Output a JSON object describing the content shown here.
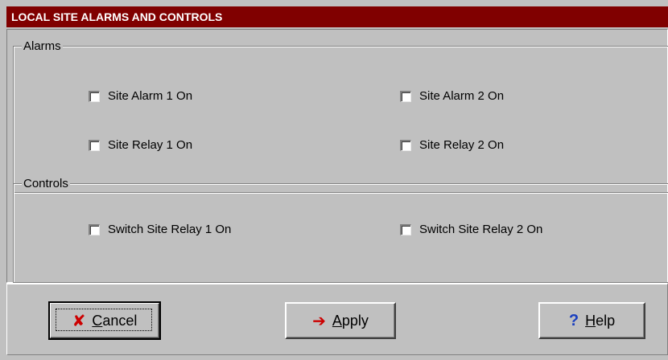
{
  "window": {
    "title": "LOCAL SITE ALARMS AND CONTROLS"
  },
  "alarms": {
    "legend": "Alarms",
    "items": [
      {
        "label": "Site Alarm 1 On",
        "checked": false
      },
      {
        "label": "Site Alarm 2 On",
        "checked": false
      },
      {
        "label": "Site Relay 1 On",
        "checked": false
      },
      {
        "label": "Site Relay 2 On",
        "checked": false
      }
    ]
  },
  "controls": {
    "legend": "Controls",
    "items": [
      {
        "label": "Switch Site Relay 1 On",
        "checked": false
      },
      {
        "label": "Switch Site Relay 2 On",
        "checked": false
      }
    ]
  },
  "buttons": {
    "cancel": {
      "icon": "x-icon",
      "mnemonic": "C",
      "rest": "ancel"
    },
    "apply": {
      "icon": "arrow-right-icon",
      "mnemonic": "A",
      "rest": "pply"
    },
    "help": {
      "icon": "question-icon",
      "mnemonic": "H",
      "rest": "elp"
    }
  },
  "colors": {
    "titlebar": "#800000",
    "face": "#c0c0c0",
    "cancel_icon": "#cc0000",
    "help_icon": "#1a3fbf"
  }
}
